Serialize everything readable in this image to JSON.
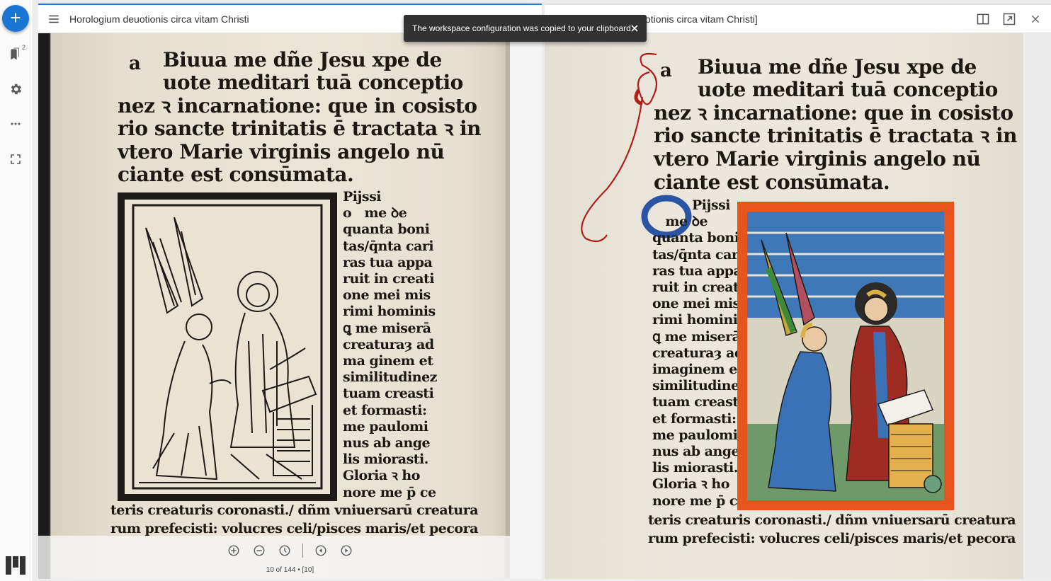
{
  "rail": {
    "add_icon": "plus-icon",
    "items": [
      {
        "icon": "bookmark-icon",
        "badge": "2"
      },
      {
        "icon": "gear-icon"
      },
      {
        "icon": "more-icon"
      },
      {
        "icon": "fullscreen-icon"
      }
    ],
    "logo": "mirador-logo"
  },
  "windows": [
    {
      "title": "Horologium deuotionis circa vitam Christi",
      "active": true
    },
    {
      "title": "otionis circa vitam Christi]",
      "actions": [
        "book-view-icon",
        "maximize-icon",
        "close-icon"
      ]
    }
  ],
  "manuscript": {
    "initial": "a",
    "lines": [
      "Biuua me dñe Jesu xpe de",
      "uote meditari tuā conceptio",
      "nez ꝛ incarnatione: que in cosisto",
      "rio sancte trinitatis ē tractata ꝛ in",
      "vtero Marie virginis angelo nū",
      "ciante est consūmata."
    ],
    "column_left": [
      "Pijssi",
      "o   me ꝺe",
      "quanta boni",
      "tas/q̄nta cari",
      "ras tua appa",
      "ruit in creati",
      "one mei mis",
      "rimi hominis",
      "ꝗ me miserā",
      "creaturaȝ ad",
      "ma ginem et",
      "similitudinez",
      "tuam creasti",
      "et formasti:",
      "me paulomi",
      "nus ab ange",
      "lis miorasti.",
      "Gloria ꝛ ho",
      "nore me p̄ ce"
    ],
    "column_right": [
      "Pijssi",
      "   me ꝺe",
      "quanta boni",
      "tas/q̄nta cari",
      "ras tua appa",
      "ruit in creati",
      "one mei mis",
      "rimi hominis",
      "ꝗ me miserā",
      "creaturaȝ ad",
      "imaginem et",
      "similitudinez",
      "tuam creasti",
      "et formasti:",
      "me paulomi",
      "nus ab ange",
      "lis miorasti.",
      "Gloria ꝛ ho",
      "nore me p̄ ce"
    ],
    "footer": [
      "teris creaturis coronasti./ dñm vniuersarū creatura",
      "rum prefecisti: volucres celi/pisces maris/et pecora"
    ]
  },
  "viewer_controls": {
    "buttons": [
      "zoom-in-icon",
      "zoom-out-icon",
      "reset-zoom-icon",
      "previous-icon",
      "next-icon"
    ],
    "page_counter": "10 of 144 • [10]"
  },
  "snackbar": {
    "message": "The workspace configuration was copied to your clipboard",
    "close_icon": "close-icon"
  },
  "colors": {
    "accent": "#1976d2",
    "snackbar_bg": "#323232",
    "rubric_red": "#b01e18",
    "frame_orange": "#e8541e",
    "initial_blue": "#2a55a5"
  }
}
